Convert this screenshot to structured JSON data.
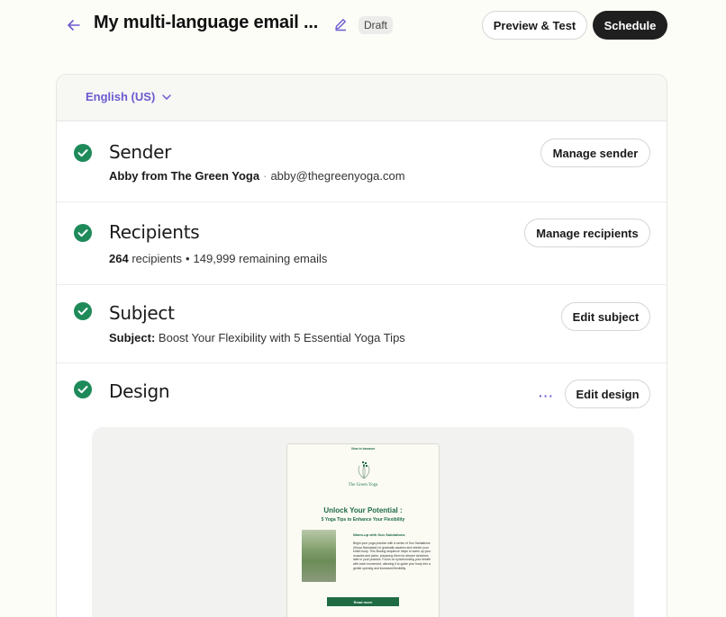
{
  "header": {
    "title": "My multi-language email ...",
    "badge": "Draft",
    "preview_label": "Preview & Test",
    "schedule_label": "Schedule"
  },
  "language": {
    "selected": "English (US)"
  },
  "sections": {
    "sender": {
      "title": "Sender",
      "name": "Abby from The Green Yoga",
      "separator": "·",
      "email": "abby@thegreenyoga.com",
      "button": "Manage sender"
    },
    "recipients": {
      "title": "Recipients",
      "count": "264",
      "count_label": "recipients",
      "separator": "•",
      "remaining": "149,999 remaining emails",
      "button": "Manage recipients"
    },
    "subject": {
      "title": "Subject",
      "label": "Subject:",
      "value": "Boost Your Flexibility with 5 Essential Yoga Tips",
      "button": "Edit subject"
    },
    "design": {
      "title": "Design",
      "more": "···",
      "button": "Edit design"
    }
  },
  "email_preview": {
    "top_link": "View in browser",
    "brand": "The Green Yoga",
    "headline": "Unlock Your Potential :",
    "subheadline": "5 Yoga Tips to Enhance Your Flexibility",
    "warmup_title": "Warm-up with Sun Salutations",
    "body": "Begin your yoga practice with a series of Sun Salutations (Surya Namaskar) to gradually awaken and stretch your entire body. This flowing sequence helps to warm up your muscles and joints, preparing them for deeper stretches later in your practice. Focus on synchronizing your breath with each movement, allowing it to guide your body into a gentle opening and increased flexibility.",
    "button": "Read more"
  },
  "colors": {
    "accent": "#6a5bd0",
    "check_green": "#1e8a5a",
    "brand_green": "#1f6b44",
    "dark_button": "#1f1f1f"
  }
}
